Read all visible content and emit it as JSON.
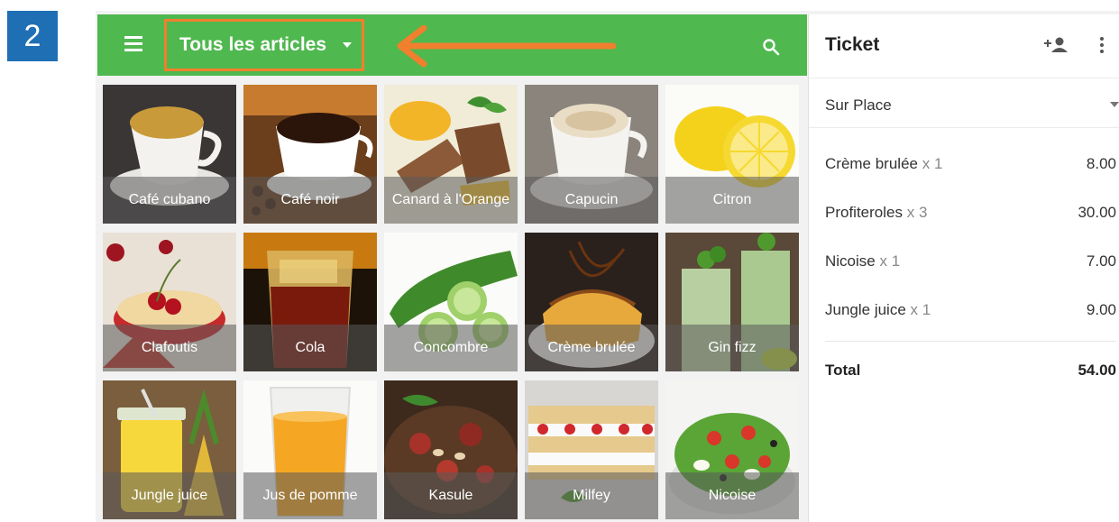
{
  "step": {
    "number": "2"
  },
  "header": {
    "category": "Tous les articles",
    "accent": "#4fb84f",
    "highlight": "#f07f2e"
  },
  "items": [
    {
      "label": "Café cubano",
      "icon": "coffee-cup"
    },
    {
      "label": "Café noir",
      "icon": "coffee-cup"
    },
    {
      "label": "Canard à l'Orange",
      "icon": "duck-dish"
    },
    {
      "label": "Capucin",
      "icon": "coffee-cup"
    },
    {
      "label": "Citron",
      "icon": "lemon"
    },
    {
      "label": "Clafoutis",
      "icon": "cherry-dessert"
    },
    {
      "label": "Cola",
      "icon": "cola-glass"
    },
    {
      "label": "Concombre",
      "icon": "cucumber"
    },
    {
      "label": "Crème brulée",
      "icon": "dessert"
    },
    {
      "label": "Gin fizz",
      "icon": "cocktail"
    },
    {
      "label": "Jungle juice",
      "icon": "juice-jar"
    },
    {
      "label": "Jus de pomme",
      "icon": "juice-glass"
    },
    {
      "label": "Kasule",
      "icon": "stew"
    },
    {
      "label": "Milfey",
      "icon": "cake"
    },
    {
      "label": "Nicoise",
      "icon": "salad"
    }
  ],
  "ticket": {
    "title": "Ticket",
    "dining": "Sur Place",
    "lines": [
      {
        "name": "Crème brulée",
        "qty": "x 1",
        "price": "8.00"
      },
      {
        "name": "Profiteroles",
        "qty": "x 3",
        "price": "30.00"
      },
      {
        "name": "Nicoise",
        "qty": "x 1",
        "price": "7.00"
      },
      {
        "name": "Jungle juice",
        "qty": "x 1",
        "price": "9.00"
      }
    ],
    "total_label": "Total",
    "total_value": "54.00"
  }
}
